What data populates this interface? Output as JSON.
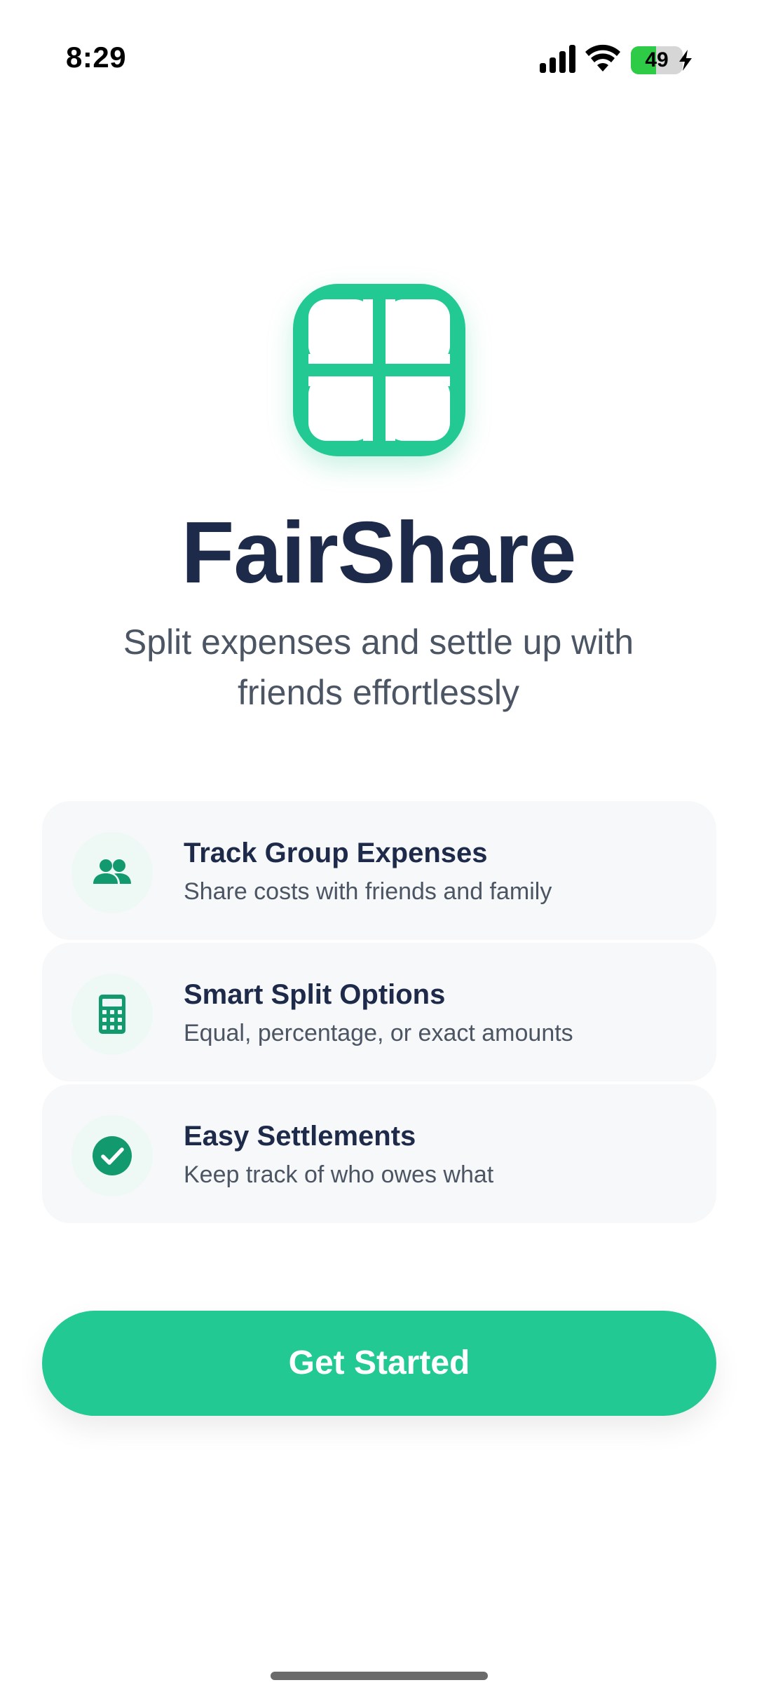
{
  "status_bar": {
    "time": "8:29",
    "battery_level": "49",
    "battery_fraction": 0.49,
    "icons": [
      "signal-icon",
      "wifi-icon",
      "battery-icon",
      "charging-bolt-icon"
    ]
  },
  "app": {
    "logo_icon": "grid-logo-icon",
    "title": "FairShare",
    "tagline": "Split expenses and settle up with friends effortlessly"
  },
  "features": [
    {
      "icon": "people-icon",
      "title": "Track Group Expenses",
      "description": "Share costs with friends and family"
    },
    {
      "icon": "calculator-icon",
      "title": "Smart Split Options",
      "description": "Equal, percentage, or exact amounts"
    },
    {
      "icon": "check-circle-icon",
      "title": "Easy Settlements",
      "description": "Keep track of who owes what"
    }
  ],
  "cta": {
    "label": "Get Started"
  },
  "colors": {
    "accent": "#22c993",
    "title": "#1e2a4a",
    "body_text": "#4b5563",
    "card_background": "#f7f8f9",
    "icon_color": "#129a6e"
  }
}
